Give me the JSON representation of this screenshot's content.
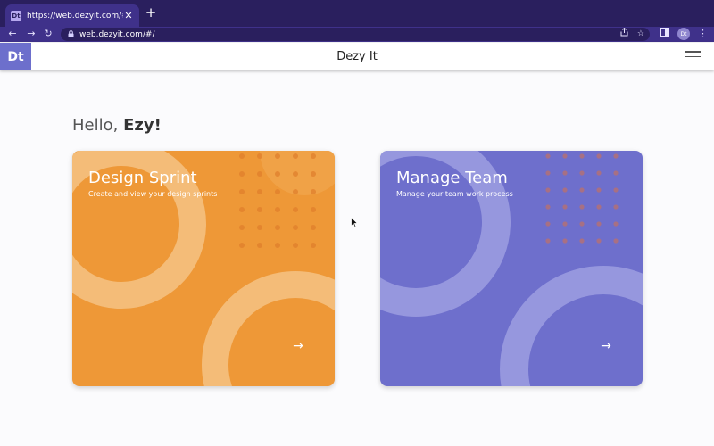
{
  "browser": {
    "tab": {
      "favicon_text": "Dt",
      "title": "https://web.dezyit.com/#/",
      "close_glyph": "✕"
    },
    "new_tab_glyph": "+",
    "nav": {
      "back": "←",
      "forward": "→",
      "reload": "↻"
    },
    "address_bar": {
      "url": "web.dezyit.com/#/",
      "lock_icon": "lock-icon"
    },
    "profile_initials": "Dt",
    "colors": {
      "tabbar": "#2a1f5e",
      "toolbar": "#3f318a"
    }
  },
  "app": {
    "logo": "Dt",
    "title": "Dezy It",
    "colors": {
      "logo_bg": "#6d6fcc",
      "header_bg": "#ffffff"
    }
  },
  "main": {
    "greeting_prefix": "Hello, ",
    "greeting_name": "Ezy!",
    "cards": [
      {
        "title": "Design Sprint",
        "subtitle": "Create and view your design sprints",
        "arrow": "→",
        "color": "#ee9837"
      },
      {
        "title": "Manage Team",
        "subtitle": "Manage your team work process",
        "arrow": "→",
        "color": "#6e6fcc"
      }
    ]
  }
}
